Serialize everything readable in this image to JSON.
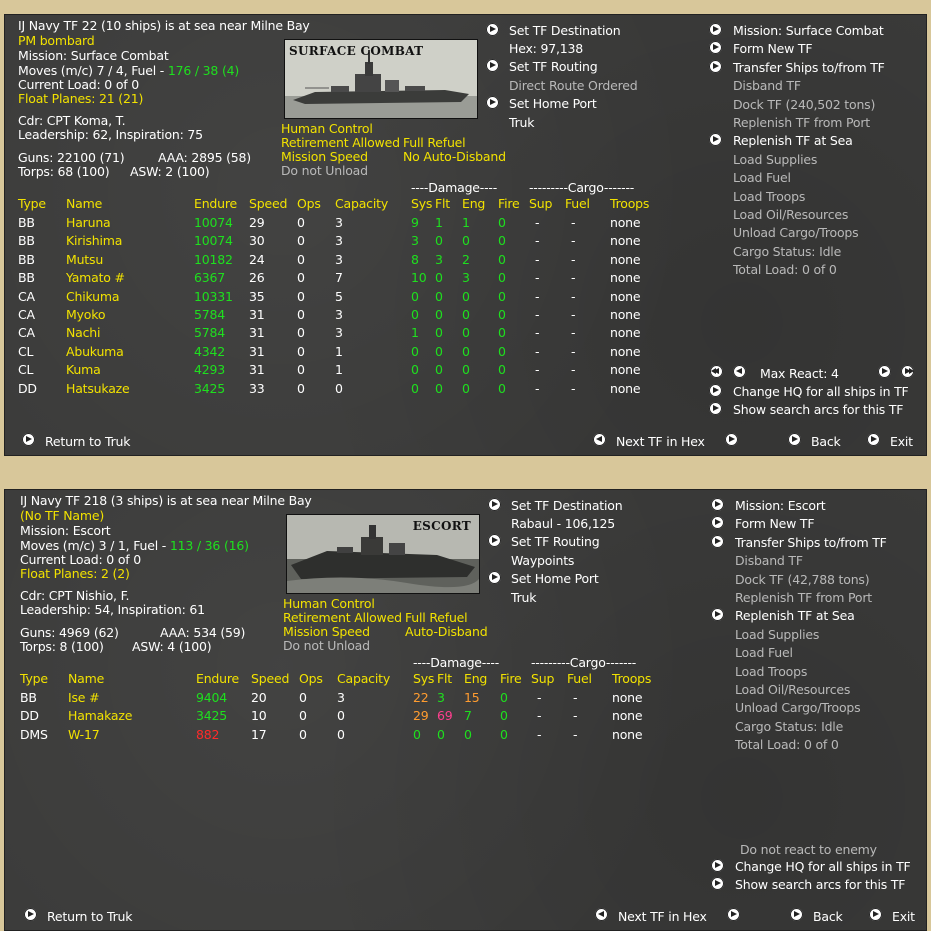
{
  "panels": [
    {
      "header": "IJ Navy TF 22 (10 ships) is at sea near Milne Bay",
      "tf_name": "PM bombard",
      "mission_line": "Mission: Surface Combat",
      "moves_prefix": "Moves (m/c) 7 / 4, Fuel - ",
      "fuel": "176 / 38 (4)",
      "current_load": "Current Load: 0 of 0",
      "float_planes": "Float Planes: 21 (21)",
      "cdr": "Cdr: CPT Koma, T.",
      "leadership": "Leadership: 62, Inspiration: 75",
      "guns": "Guns: 22100 (71)",
      "aaa": "AAA: 2895 (58)",
      "torps": "Torps: 68 (100)",
      "asw": "ASW: 2 (100)",
      "image_caption": "SURFACE COMBAT",
      "options": {
        "human": "Human Control",
        "retire": "Retirement Allowed",
        "refuel": "Full Refuel",
        "speed": "Mission Speed",
        "disband": "No Auto-Disband",
        "unload": "Do not Unload"
      },
      "mid": {
        "dest": "Set TF Destination",
        "hex": "Hex: 97,138",
        "routing": "Set TF Routing",
        "route_sub": "Direct Route Ordered",
        "home": "Set Home Port",
        "home_port": "Truk"
      },
      "right": [
        {
          "label": "Mission: Surface Combat",
          "btn": true,
          "cls": "w"
        },
        {
          "label": "Form New TF",
          "btn": true,
          "cls": "w"
        },
        {
          "label": "Transfer Ships to/from TF",
          "btn": true,
          "cls": "w"
        },
        {
          "label": "Disband TF",
          "btn": false,
          "cls": "gr"
        },
        {
          "label": "Dock TF (240,502 tons)",
          "btn": false,
          "cls": "gr"
        },
        {
          "label": "Replenish TF from Port",
          "btn": false,
          "cls": "gr"
        },
        {
          "label": "Replenish TF at Sea",
          "btn": true,
          "cls": "w"
        },
        {
          "label": "Load Supplies",
          "btn": false,
          "cls": "gr"
        },
        {
          "label": "Load Fuel",
          "btn": false,
          "cls": "gr"
        },
        {
          "label": "Load Troops",
          "btn": false,
          "cls": "gr"
        },
        {
          "label": "Load Oil/Resources",
          "btn": false,
          "cls": "gr"
        },
        {
          "label": "Unload Cargo/Troops",
          "btn": false,
          "cls": "gr"
        },
        {
          "label": "Cargo Status: Idle",
          "btn": false,
          "cls": "gr"
        },
        {
          "label": "Total Load: 0 of 0",
          "btn": false,
          "cls": "gr"
        }
      ],
      "max_react": "Max React: 4",
      "react_note": "",
      "change_hq": "Change HQ for all ships in TF",
      "search_arcs": "Show search arcs for this TF",
      "headers": {
        "damage": "----Damage----",
        "cargo": "---------Cargo-------",
        "type": "Type",
        "name": "Name",
        "endure": "Endure",
        "speed": "Speed",
        "ops": "Ops",
        "capacity": "Capacity",
        "sys": "Sys",
        "flt": "Flt",
        "eng": "Eng",
        "fire": "Fire",
        "sup": "Sup",
        "fuel": "Fuel",
        "troops": "Troops"
      },
      "ships": [
        {
          "type": "BB",
          "name": "Haruna",
          "endure": "10074",
          "endure_c": "g",
          "speed": "29",
          "ops": "0",
          "capacity": "3",
          "sys": "9",
          "sys_c": "g",
          "flt": "1",
          "flt_c": "g",
          "eng": "1",
          "eng_c": "g",
          "fire": "0",
          "sup": "-",
          "fuel": "-",
          "troops": "none"
        },
        {
          "type": "BB",
          "name": "Kirishima",
          "endure": "10074",
          "endure_c": "g",
          "speed": "30",
          "ops": "0",
          "capacity": "3",
          "sys": "3",
          "sys_c": "g",
          "flt": "0",
          "flt_c": "g",
          "eng": "0",
          "eng_c": "g",
          "fire": "0",
          "sup": "-",
          "fuel": "-",
          "troops": "none"
        },
        {
          "type": "BB",
          "name": "Mutsu",
          "endure": "10182",
          "endure_c": "g",
          "speed": "24",
          "ops": "0",
          "capacity": "3",
          "sys": "8",
          "sys_c": "g",
          "flt": "3",
          "flt_c": "g",
          "eng": "2",
          "eng_c": "g",
          "fire": "0",
          "sup": "-",
          "fuel": "-",
          "troops": "none"
        },
        {
          "type": "BB",
          "name": "Yamato #",
          "endure": "6367",
          "endure_c": "g",
          "speed": "26",
          "ops": "0",
          "capacity": "7",
          "sys": "10",
          "sys_c": "g",
          "flt": "0",
          "flt_c": "g",
          "eng": "3",
          "eng_c": "g",
          "fire": "0",
          "sup": "-",
          "fuel": "-",
          "troops": "none"
        },
        {
          "type": "CA",
          "name": "Chikuma",
          "endure": "10331",
          "endure_c": "g",
          "speed": "35",
          "ops": "0",
          "capacity": "5",
          "sys": "0",
          "sys_c": "g",
          "flt": "0",
          "flt_c": "g",
          "eng": "0",
          "eng_c": "g",
          "fire": "0",
          "sup": "-",
          "fuel": "-",
          "troops": "none"
        },
        {
          "type": "CA",
          "name": "Myoko",
          "endure": "5784",
          "endure_c": "g",
          "speed": "31",
          "ops": "0",
          "capacity": "3",
          "sys": "0",
          "sys_c": "g",
          "flt": "0",
          "flt_c": "g",
          "eng": "0",
          "eng_c": "g",
          "fire": "0",
          "sup": "-",
          "fuel": "-",
          "troops": "none"
        },
        {
          "type": "CA",
          "name": "Nachi",
          "endure": "5784",
          "endure_c": "g",
          "speed": "31",
          "ops": "0",
          "capacity": "3",
          "sys": "1",
          "sys_c": "g",
          "flt": "0",
          "flt_c": "g",
          "eng": "0",
          "eng_c": "g",
          "fire": "0",
          "sup": "-",
          "fuel": "-",
          "troops": "none"
        },
        {
          "type": "CL",
          "name": "Abukuma",
          "endure": "4342",
          "endure_c": "g",
          "speed": "31",
          "ops": "0",
          "capacity": "1",
          "sys": "0",
          "sys_c": "g",
          "flt": "0",
          "flt_c": "g",
          "eng": "0",
          "eng_c": "g",
          "fire": "0",
          "sup": "-",
          "fuel": "-",
          "troops": "none"
        },
        {
          "type": "CL",
          "name": "Kuma",
          "endure": "4293",
          "endure_c": "g",
          "speed": "31",
          "ops": "0",
          "capacity": "1",
          "sys": "0",
          "sys_c": "g",
          "flt": "0",
          "flt_c": "g",
          "eng": "0",
          "eng_c": "g",
          "fire": "0",
          "sup": "-",
          "fuel": "-",
          "troops": "none"
        },
        {
          "type": "DD",
          "name": "Hatsukaze",
          "endure": "3425",
          "endure_c": "g",
          "speed": "33",
          "ops": "0",
          "capacity": "0",
          "sys": "0",
          "sys_c": "g",
          "flt": "0",
          "flt_c": "g",
          "eng": "0",
          "eng_c": "g",
          "fire": "0",
          "sup": "-",
          "fuel": "-",
          "troops": "none"
        }
      ],
      "return": "Return to Truk",
      "next_tf": "Next TF in Hex",
      "back": "Back",
      "exit": "Exit"
    },
    {
      "header": "IJ Navy TF 218 (3 ships) is at sea near Milne Bay",
      "tf_name": "(No TF Name)",
      "mission_line": "Mission: Escort",
      "moves_prefix": "Moves (m/c) 3 / 1, Fuel - ",
      "fuel": "113 / 36 (16)",
      "current_load": "Current Load: 0 of 0",
      "float_planes": "Float Planes: 2 (2)",
      "cdr": "Cdr: CPT Nishio, F.",
      "leadership": "Leadership: 54, Inspiration: 61",
      "guns": "Guns: 4969 (62)",
      "aaa": "AAA: 534 (59)",
      "torps": "Torps: 8 (100)",
      "asw": "ASW: 4 (100)",
      "image_caption": "ESCORT",
      "options": {
        "human": "Human Control",
        "retire": "Retirement Allowed",
        "refuel": "Full Refuel",
        "speed": "Mission Speed",
        "disband": "Auto-Disband",
        "unload": "Do not Unload"
      },
      "mid": {
        "dest": "Set TF Destination",
        "hex": "Rabaul - 106,125",
        "routing": "Set TF Routing",
        "route_sub": "Waypoints",
        "home": "Set Home Port",
        "home_port": "Truk"
      },
      "right": [
        {
          "label": "Mission: Escort",
          "btn": true,
          "cls": "w"
        },
        {
          "label": "Form New TF",
          "btn": true,
          "cls": "w"
        },
        {
          "label": "Transfer Ships to/from TF",
          "btn": true,
          "cls": "w"
        },
        {
          "label": "Disband TF",
          "btn": false,
          "cls": "gr"
        },
        {
          "label": "Dock TF (42,788 tons)",
          "btn": false,
          "cls": "gr"
        },
        {
          "label": "Replenish TF from Port",
          "btn": false,
          "cls": "gr"
        },
        {
          "label": "Replenish TF at Sea",
          "btn": true,
          "cls": "w"
        },
        {
          "label": "Load Supplies",
          "btn": false,
          "cls": "gr"
        },
        {
          "label": "Load Fuel",
          "btn": false,
          "cls": "gr"
        },
        {
          "label": "Load Troops",
          "btn": false,
          "cls": "gr"
        },
        {
          "label": "Load Oil/Resources",
          "btn": false,
          "cls": "gr"
        },
        {
          "label": "Unload Cargo/Troops",
          "btn": false,
          "cls": "gr"
        },
        {
          "label": "Cargo Status: Idle",
          "btn": false,
          "cls": "gr"
        },
        {
          "label": "Total Load: 0 of 0",
          "btn": false,
          "cls": "gr"
        }
      ],
      "max_react": "",
      "react_note": "Do not react to enemy",
      "change_hq": "Change HQ for all ships in TF",
      "search_arcs": "Show search arcs for this TF",
      "headers": {
        "damage": "----Damage----",
        "cargo": "---------Cargo-------",
        "type": "Type",
        "name": "Name",
        "endure": "Endure",
        "speed": "Speed",
        "ops": "Ops",
        "capacity": "Capacity",
        "sys": "Sys",
        "flt": "Flt",
        "eng": "Eng",
        "fire": "Fire",
        "sup": "Sup",
        "fuel": "Fuel",
        "troops": "Troops"
      },
      "ships": [
        {
          "type": "BB",
          "name": "Ise #",
          "endure": "9404",
          "endure_c": "g",
          "speed": "20",
          "ops": "0",
          "capacity": "3",
          "sys": "22",
          "sys_c": "o",
          "flt": "3",
          "flt_c": "g",
          "eng": "15",
          "eng_c": "o",
          "fire": "0",
          "sup": "-",
          "fuel": "-",
          "troops": "none"
        },
        {
          "type": "DD",
          "name": "Hamakaze",
          "endure": "3425",
          "endure_c": "g",
          "speed": "10",
          "ops": "0",
          "capacity": "0",
          "sys": "29",
          "sys_c": "o",
          "flt": "69",
          "flt_c": "pk",
          "eng": "7",
          "eng_c": "g",
          "fire": "0",
          "sup": "-",
          "fuel": "-",
          "troops": "none"
        },
        {
          "type": "DMS",
          "name": "W-17",
          "endure": "882",
          "endure_c": "r",
          "speed": "17",
          "ops": "0",
          "capacity": "0",
          "sys": "0",
          "sys_c": "g",
          "flt": "0",
          "flt_c": "g",
          "eng": "0",
          "eng_c": "g",
          "fire": "0",
          "sup": "-",
          "fuel": "-",
          "troops": "none"
        }
      ],
      "return": "Return to Truk",
      "next_tf": "Next TF in Hex",
      "back": "Back",
      "exit": "Exit"
    }
  ]
}
